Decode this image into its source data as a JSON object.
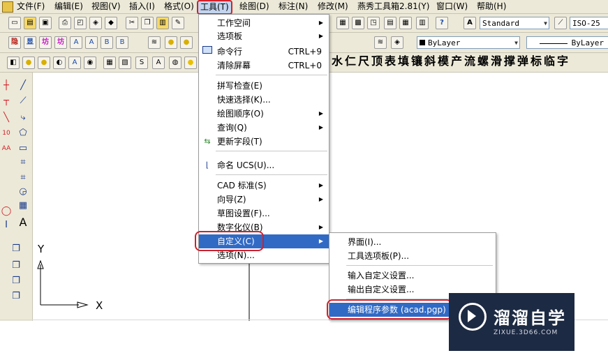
{
  "menubar": {
    "items": [
      {
        "label": "文件(F)"
      },
      {
        "label": "编辑(E)"
      },
      {
        "label": "视图(V)"
      },
      {
        "label": "插入(I)"
      },
      {
        "label": "格式(O)"
      },
      {
        "label": "工具(T)"
      },
      {
        "label": "绘图(D)"
      },
      {
        "label": "标注(N)"
      },
      {
        "label": "修改(M)"
      },
      {
        "label": "燕秀工具箱2.81(Y)"
      },
      {
        "label": "窗口(W)"
      },
      {
        "label": "帮助(H)"
      }
    ]
  },
  "toolbar": {
    "text_style": "Standard",
    "dim_style": "ISO-25",
    "color": "ByLayer",
    "linetype": "ByLayer",
    "layer_buttons": [
      "隐",
      "显",
      "坊",
      "坊"
    ]
  },
  "char_strip": "水仁尺顶表填镶斜模产流螺滑撑弹标临字",
  "tools_menu": {
    "items": [
      {
        "label": "工作空间",
        "shortcut": ""
      },
      {
        "label": "选项板",
        "shortcut": ""
      },
      {
        "label": "命令行",
        "shortcut": "CTRL+9"
      },
      {
        "label": "清除屏幕",
        "shortcut": "CTRL+0"
      },
      {
        "label": "拼写检查(E)",
        "shortcut": ""
      },
      {
        "label": "快速选择(K)...",
        "shortcut": ""
      },
      {
        "label": "绘图顺序(O)",
        "shortcut": ""
      },
      {
        "label": "查询(Q)",
        "shortcut": ""
      },
      {
        "label": "更新字段(T)",
        "shortcut": ""
      },
      {
        "label": "命名 UCS(U)...",
        "shortcut": ""
      },
      {
        "label": "CAD 标准(S)",
        "shortcut": ""
      },
      {
        "label": "向导(Z)",
        "shortcut": ""
      },
      {
        "label": "草图设置(F)...",
        "shortcut": ""
      },
      {
        "label": "数字化仪(B)",
        "shortcut": ""
      },
      {
        "label": "自定义(C)",
        "shortcut": ""
      },
      {
        "label": "选项(N)...",
        "shortcut": ""
      }
    ]
  },
  "custom_menu": {
    "items": [
      {
        "label": "界面(I)..."
      },
      {
        "label": "工具选项板(P)..."
      },
      {
        "label": "输入自定义设置..."
      },
      {
        "label": "输出自定义设置..."
      },
      {
        "label": "编辑程序参数 (acad.pgp)"
      }
    ]
  },
  "ucs": {
    "y": "Y",
    "x": "X"
  },
  "watermark": {
    "title": "溜溜自学",
    "url": "ZIXUE.3D66.COM"
  },
  "colors": {
    "highlight": "#316ac5",
    "annotation": "#d0202a",
    "menubar": "#ece9d8"
  }
}
